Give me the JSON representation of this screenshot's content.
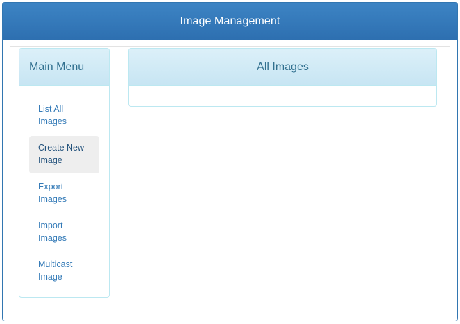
{
  "window": {
    "title": "Image Management"
  },
  "sidebar": {
    "heading": "Main Menu",
    "items": [
      {
        "label": "List All Images",
        "active": false
      },
      {
        "label": "Create New Image",
        "active": true
      },
      {
        "label": "Export Images",
        "active": false
      },
      {
        "label": "Import Images",
        "active": false
      },
      {
        "label": "Multicast Image",
        "active": false
      }
    ]
  },
  "main": {
    "heading": "All Images"
  },
  "colors": {
    "titlebar": "#2d6fb0",
    "panel_heading_bg": "#d1eaf6",
    "panel_heading_text": "#31708f",
    "link": "#337ab7",
    "active_item_bg": "#eeeeee"
  }
}
